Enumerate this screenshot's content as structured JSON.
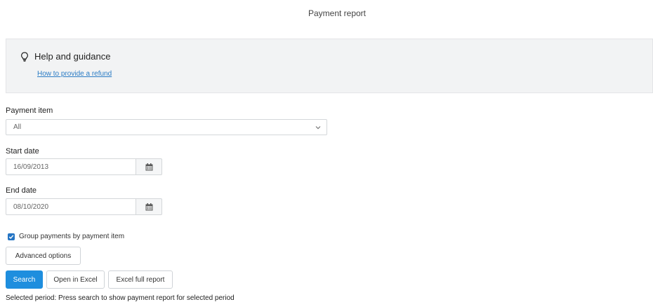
{
  "page": {
    "title": "Payment report"
  },
  "help": {
    "heading": "Help and guidance",
    "link_text": "How to provide a refund"
  },
  "payment_item": {
    "label": "Payment item",
    "selected": "All"
  },
  "start_date": {
    "label": "Start date",
    "value": "16/09/2013"
  },
  "end_date": {
    "label": "End date",
    "value": "08/10/2020"
  },
  "group_by": {
    "label": "Group payments by payment item",
    "checked": true
  },
  "buttons": {
    "advanced": "Advanced options",
    "search": "Search",
    "open_excel": "Open in Excel",
    "excel_full": "Excel full report"
  },
  "status": {
    "selected_period": "Selected period: Press search to show payment report for selected period"
  },
  "colors": {
    "primary": "#1e8ede",
    "link": "#2a7bc4",
    "panel_bg": "#f2f3f4",
    "checkbox": "#2575c4"
  }
}
